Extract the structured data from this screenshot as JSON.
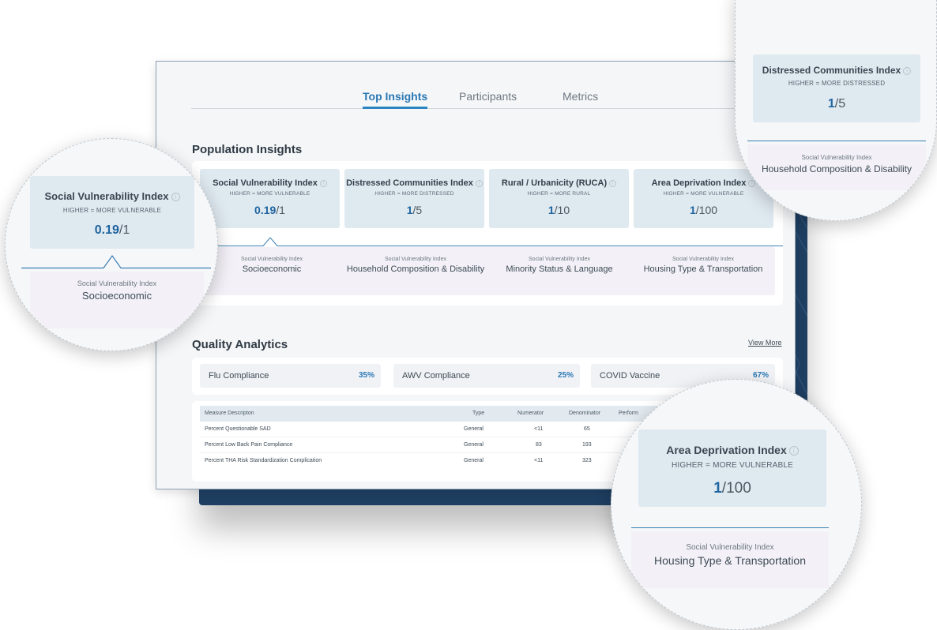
{
  "tabs": [
    {
      "label": "Top Insights"
    },
    {
      "label": "Participants"
    },
    {
      "label": "Metrics"
    }
  ],
  "population_insights": {
    "title": "Population Insights",
    "indices": [
      {
        "title": "Social Vulnerability Index",
        "subtitle": "HIGHER = MORE VULNERABLE",
        "value": "0.19",
        "max": "/1"
      },
      {
        "title": "Distressed Communities Index",
        "subtitle": "HIGHER = MORE DISTRESSED",
        "value": "1",
        "max": "/5"
      },
      {
        "title": "Rural / Urbanicity (RUCA)",
        "subtitle": "HIGHER = MORE RURAL",
        "value": "1",
        "max": "/10"
      },
      {
        "title": "Area Deprivation Index",
        "subtitle": "HIGHER = MORE VULNERABLE",
        "value": "1",
        "max": "/100"
      }
    ],
    "subindices": [
      {
        "label": "Social Vulnerability Index",
        "name": "Socioeconomic"
      },
      {
        "label": "Social Vulnerability Index",
        "name": "Household Composition & Disability"
      },
      {
        "label": "Social Vulnerability Index",
        "name": "Minority Status & Language"
      },
      {
        "label": "Social Vulnerability Index",
        "name": "Housing Type & Transportation"
      }
    ]
  },
  "quality_analytics": {
    "title": "Quality Analytics",
    "view_more": "View More",
    "metrics": [
      {
        "label": "Flu Compliance",
        "value": "35%"
      },
      {
        "label": "AWV Compliance",
        "value": "25%"
      },
      {
        "label": "COVID Vaccine",
        "value": "67%"
      }
    ],
    "table": {
      "headers": [
        "Measure Descripton",
        "Type",
        "Numerator",
        "Denominator",
        "Perform"
      ],
      "rows": [
        [
          "Percent Questionable SAD",
          "General",
          "<11",
          "65"
        ],
        [
          "Percent Low Back Pain Compliance",
          "General",
          "83",
          "193"
        ],
        [
          "Percent THA Risk Standardization Complication",
          "General",
          "<11",
          "323"
        ]
      ]
    }
  },
  "info_icon": "info-circle-icon",
  "colors": {
    "accent": "#2978b5",
    "card_bg": "#dfe9f0",
    "strip_bg": "#f3f1f7",
    "backdrop": "#1f3f62"
  }
}
